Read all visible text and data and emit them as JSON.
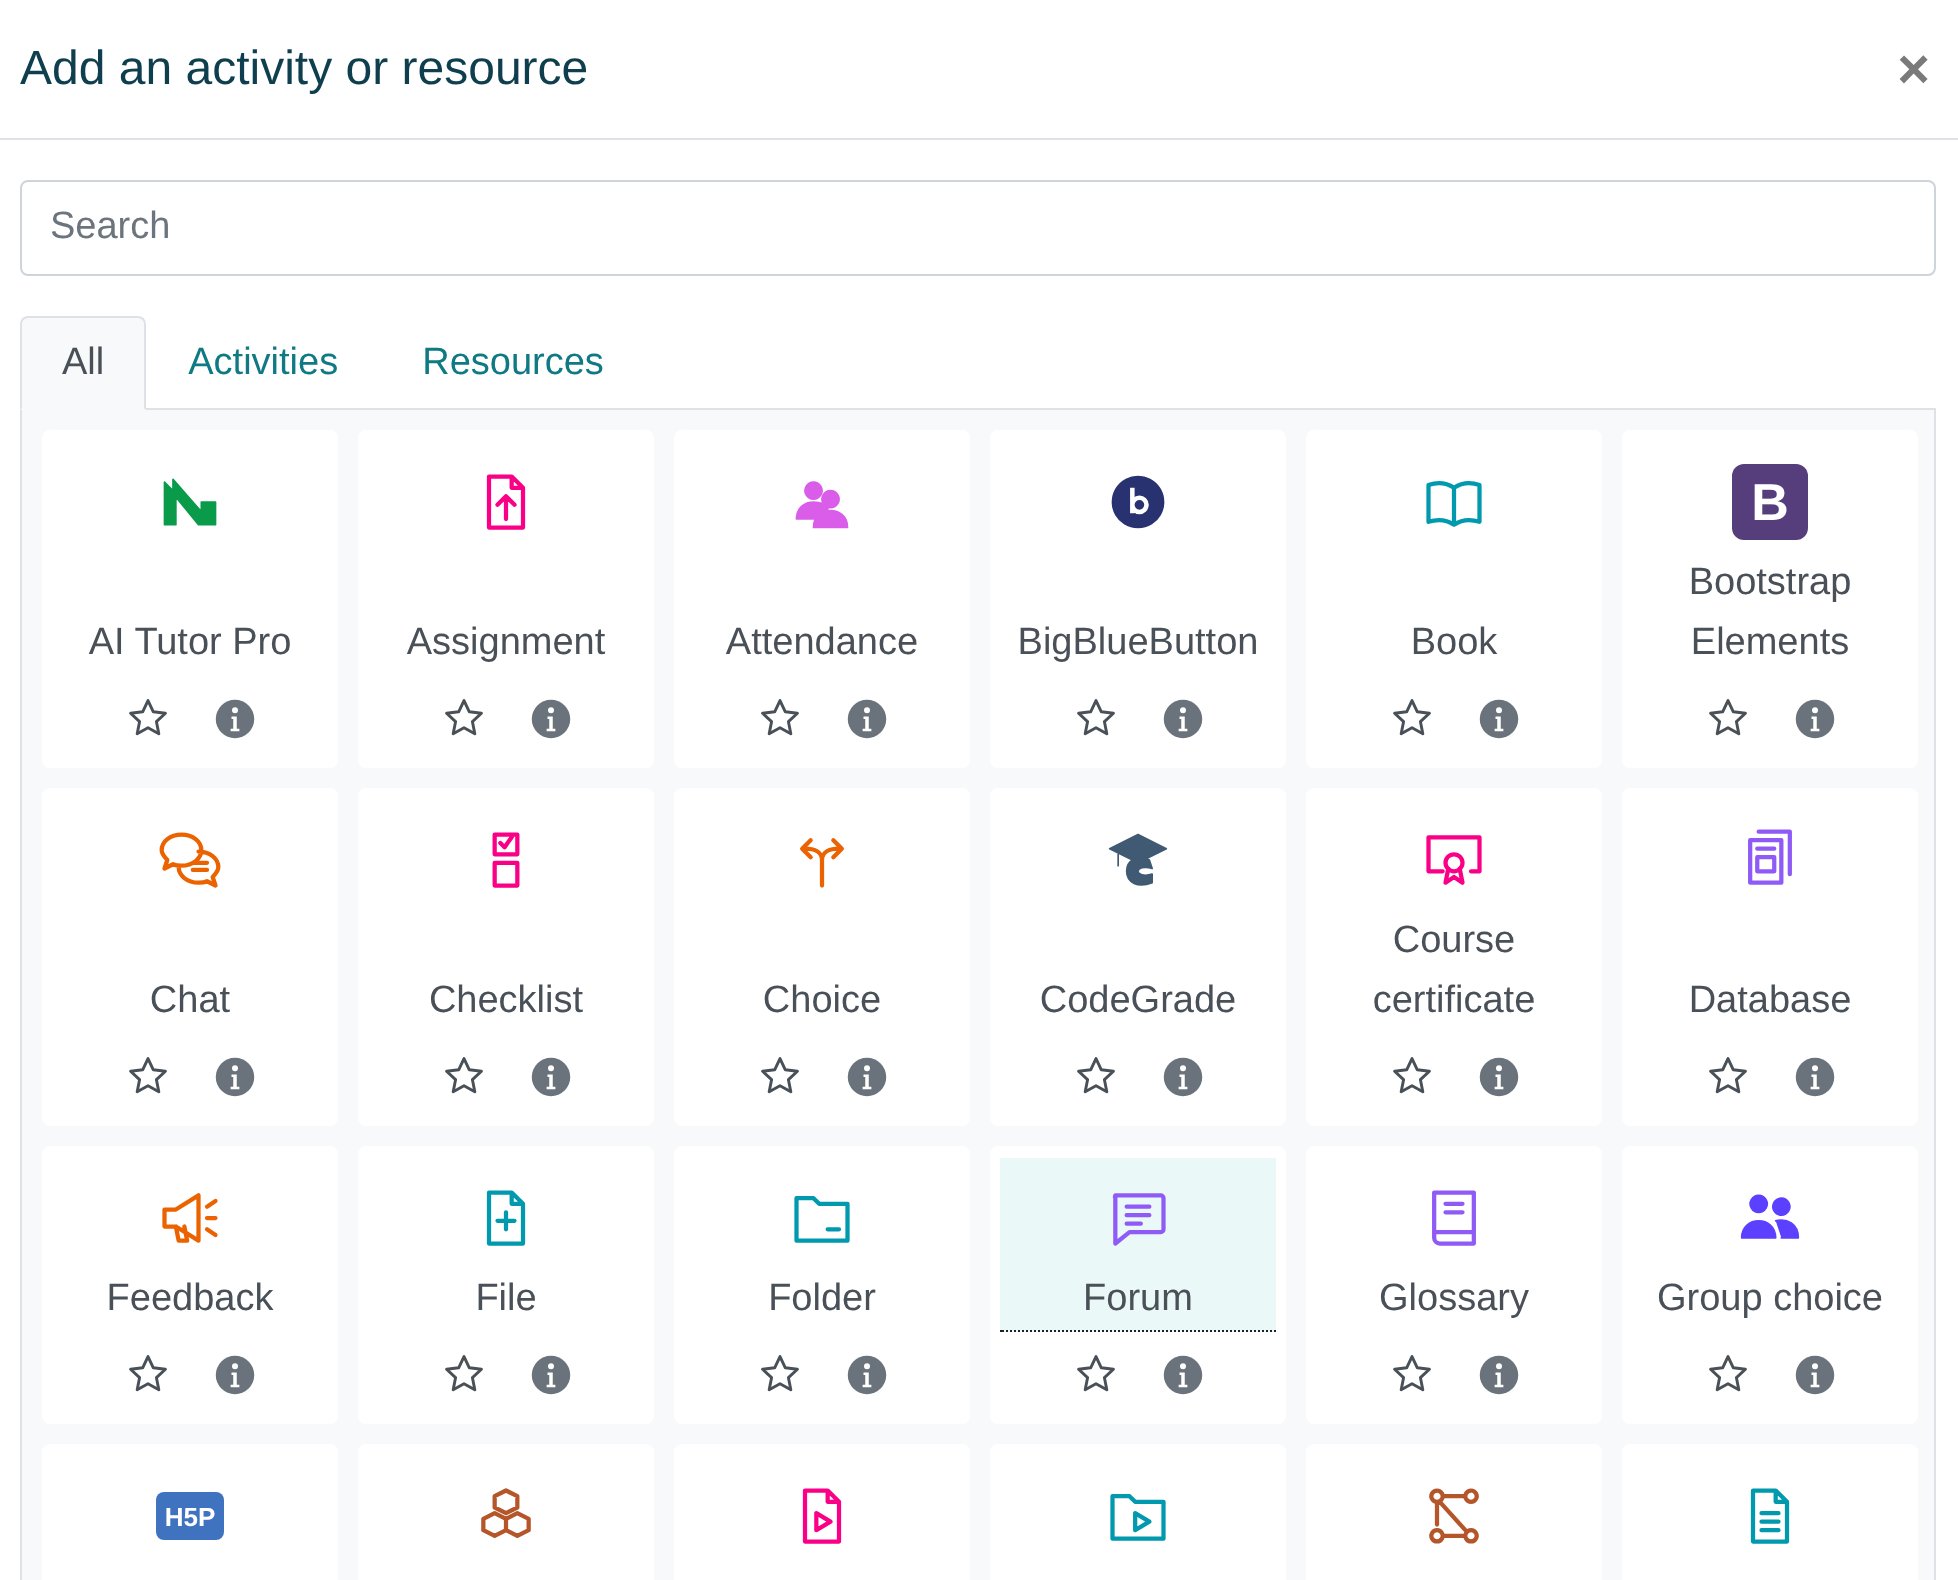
{
  "dialog": {
    "title": "Add an activity or resource",
    "close": "×"
  },
  "search": {
    "placeholder": "Search"
  },
  "tabs": [
    {
      "label": "All",
      "selected": true
    },
    {
      "label": "Activities",
      "selected": false
    },
    {
      "label": "Resources",
      "selected": false
    }
  ],
  "items": [
    {
      "label": "AI Tutor Pro",
      "color": "#0a9b4a",
      "selected": false
    },
    {
      "label": "Assignment",
      "color": "#f90086",
      "selected": false
    },
    {
      "label": "Attendance",
      "color": "#d95de8",
      "selected": false
    },
    {
      "label": "BigBlueButton",
      "color": "#283271",
      "selected": false
    },
    {
      "label": "Book",
      "color": "#0099ad",
      "selected": false
    },
    {
      "label": "Bootstrap Elements",
      "color": "#563d7c",
      "icon_text": "B",
      "selected": false
    },
    {
      "label": "Chat",
      "color": "#eb6200",
      "selected": false
    },
    {
      "label": "Checklist",
      "color": "#f90086",
      "selected": false
    },
    {
      "label": "Choice",
      "color": "#eb6200",
      "selected": false
    },
    {
      "label": "CodeGrade",
      "color": "#3f5a72",
      "selected": false
    },
    {
      "label": "Course certificate",
      "color": "#f90086",
      "selected": false
    },
    {
      "label": "Database",
      "color": "#8f5bf6",
      "selected": false
    },
    {
      "label": "Feedback",
      "color": "#eb6200",
      "selected": false
    },
    {
      "label": "File",
      "color": "#0099ad",
      "selected": false
    },
    {
      "label": "Folder",
      "color": "#0099ad",
      "selected": false
    },
    {
      "label": "Forum",
      "color": "#8f5bf6",
      "selected": true
    },
    {
      "label": "Glossary",
      "color": "#8f5bf6",
      "selected": false
    },
    {
      "label": "Group choice",
      "color": "#5b40ff",
      "selected": false
    },
    {
      "color": "#3f73c0",
      "icon_text": "H5P",
      "selected": false
    },
    {
      "color": "#b5552a",
      "selected": false
    },
    {
      "color": "#f90086",
      "selected": false
    },
    {
      "color": "#0099ad",
      "selected": false
    },
    {
      "color": "#b5552a",
      "selected": false
    },
    {
      "color": "#0099ad",
      "selected": false
    }
  ]
}
